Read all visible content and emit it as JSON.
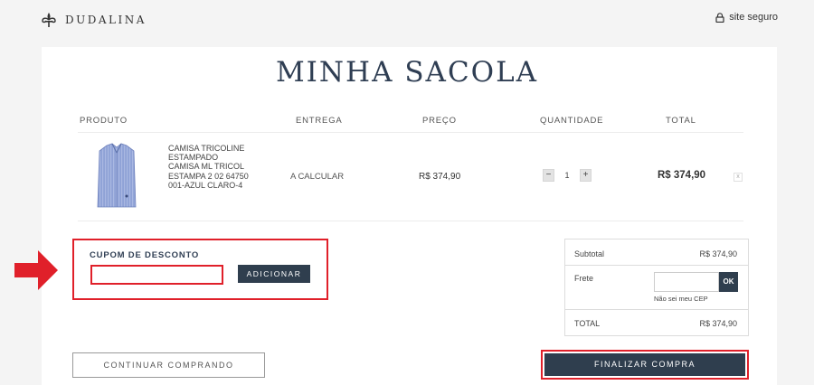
{
  "brand": {
    "name": "DUDALINA",
    "logo_icon": "fleur-de-lis-icon"
  },
  "header": {
    "secure_label": "site seguro",
    "secure_icon": "lock-icon"
  },
  "page": {
    "title": "MINHA SACOLA"
  },
  "table": {
    "columns": [
      "PRODUTO",
      "ENTREGA",
      "PREÇO",
      "QUANTIDADE",
      "TOTAL"
    ],
    "items": [
      {
        "name": "CAMISA TRICOLINE ESTAMPADO CAMISA ML TRICOL ESTAMPA 2 02 64750 001-AZUL CLARO-4",
        "delivery": "A CALCULAR",
        "price": "R$ 374,90",
        "quantity": "1",
        "qty_minus": "−",
        "qty_plus": "+",
        "total": "R$ 374,90",
        "remove_icon": "close-icon",
        "remove_label": "x",
        "image_icon": "shirt-icon"
      }
    ]
  },
  "coupon": {
    "label": "CUPOM DE DESCONTO",
    "value": "",
    "button_label": "ADICIONAR"
  },
  "summary": {
    "subtotal_label": "Subtotal",
    "subtotal_value": "R$ 374,90",
    "shipping_label": "Frete",
    "cep_value": "",
    "cep_button": "OK",
    "cep_link": "Não sei meu CEP",
    "total_label": "TOTAL",
    "total_value": "R$ 374,90"
  },
  "actions": {
    "continue_label": "CONTINUAR COMPRANDO",
    "finalize_label": "FINALIZAR COMPRA"
  },
  "colors": {
    "accent_navy": "#2f3e4e",
    "highlight_red": "#e0202a",
    "background": "#f4f4f4"
  }
}
